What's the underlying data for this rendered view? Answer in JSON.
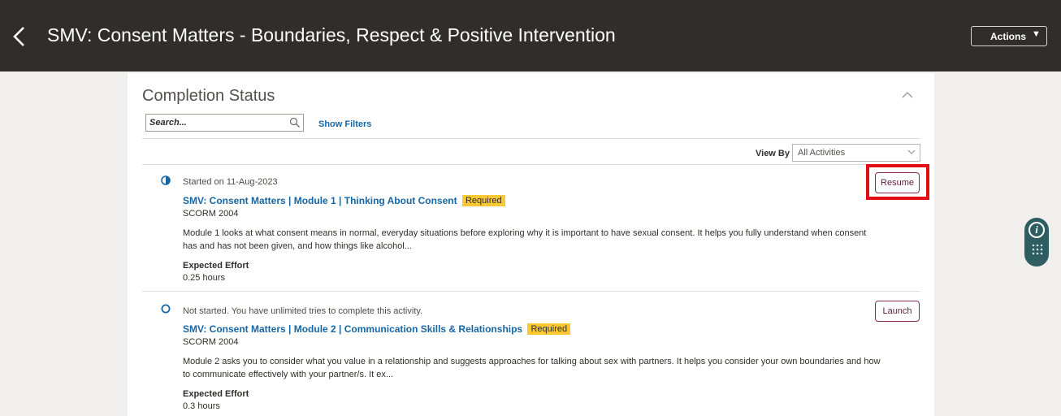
{
  "header": {
    "back_label": "Back",
    "title": "SMV: Consent Matters - Boundaries, Respect & Positive Intervention",
    "actions_label": "Actions",
    "actions_caret": "▼"
  },
  "completion": {
    "section_title": "Completion Status",
    "search_placeholder": "Search...",
    "show_filters_label": "Show Filters",
    "view_by_label": "View By",
    "view_by_value": "All Activities",
    "items": [
      {
        "status_icon": "half-circle-icon",
        "status": "Started on 11-Aug-2023",
        "title": "SMV: Consent Matters | Module 1 | Thinking About Consent",
        "badge": "Required",
        "type": "SCORM 2004",
        "description": "Module 1 looks at what consent means in normal, everyday situations before exploring why it is important to have sexual consent. It helps you fully understand when consent has and has not been given, and how things like alcohol...",
        "effort_label": "Expected Effort",
        "effort_value": "0.25 hours",
        "button_label": "Resume"
      },
      {
        "status_icon": "empty-circle-icon",
        "status": "Not started. You have unlimited tries to complete this activity.",
        "title": "SMV: Consent Matters | Module 2 | Communication Skills & Relationships",
        "badge": "Required",
        "type": "SCORM 2004",
        "description": "Module 2 asks you to consider what you value in a relationship and suggests approaches for talking about sex with partners. It helps you consider your own boundaries and how to communicate effectively with your partner/s. It ex...",
        "effort_label": "Expected Effort",
        "effort_value": "0.3 hours",
        "button_label": "Launch"
      }
    ]
  },
  "side_widget": {
    "info_glyph": "i"
  },
  "colors": {
    "header_bg": "#312d2a",
    "link": "#1766a3",
    "badge": "#f9c833",
    "button_border": "#8b2a55",
    "highlight": "#e30b14",
    "widget": "#2f5e62"
  }
}
